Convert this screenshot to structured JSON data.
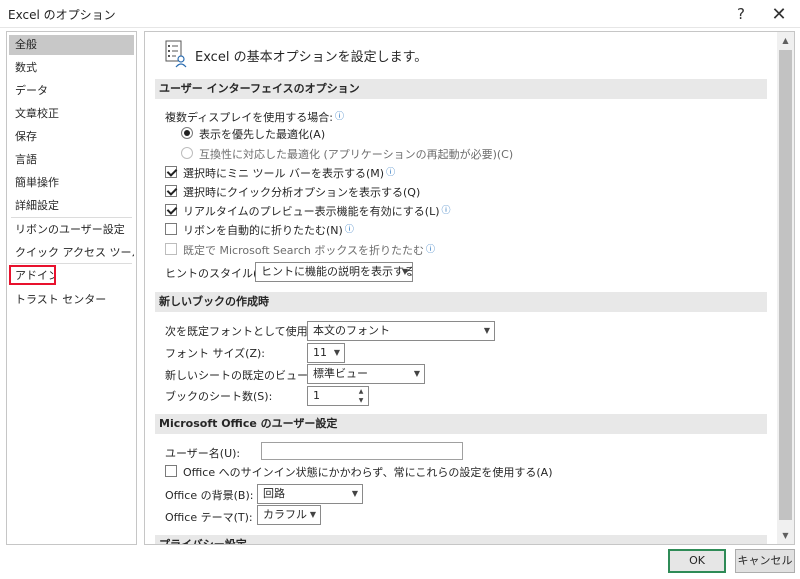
{
  "window": {
    "title": "Excel のオプション",
    "help_glyph": "?",
    "close_glyph": "✕"
  },
  "sidebar": {
    "items": [
      {
        "label": "全般"
      },
      {
        "label": "数式"
      },
      {
        "label": "データ"
      },
      {
        "label": "文章校正"
      },
      {
        "label": "保存"
      },
      {
        "label": "言語"
      },
      {
        "label": "簡単操作"
      },
      {
        "label": "詳細設定"
      },
      {
        "label": "リボンのユーザー設定"
      },
      {
        "label": "クイック アクセス ツール バー"
      },
      {
        "label": "アドイン"
      },
      {
        "label": "トラスト センター"
      }
    ]
  },
  "main": {
    "header": "Excel の基本オプションを設定します。",
    "ui_section": {
      "title": "ユーザー インターフェイスのオプション",
      "multi_display_label": "複数ディスプレイを使用する場合:",
      "radio_optimize_appearance": "表示を優先した最適化(A)",
      "radio_optimize_compat": "互換性に対応した最適化 (アプリケーションの再起動が必要)(C)",
      "cb_mini_toolbar": "選択時にミニ ツール バーを表示する(M)",
      "cb_quick_analysis": "選択時にクイック分析オプションを表示する(Q)",
      "cb_live_preview": "リアルタイムのプレビュー表示機能を有効にする(L)",
      "cb_collapse_ribbon": "リボンを自動的に折りたたむ(N)",
      "cb_collapse_search": "既定で Microsoft Search ボックスを折りたたむ",
      "tooltip_style_label": "ヒントのスタイル(R):",
      "tooltip_style_value": "ヒントに機能の説明を表示する"
    },
    "workbook_section": {
      "title": "新しいブックの作成時",
      "default_font_label": "次を既定フォントとして使用(N):",
      "default_font_value": "本文のフォント",
      "font_size_label": "フォント サイズ(Z):",
      "font_size_value": "11",
      "default_view_label": "新しいシートの既定のビュー(V):",
      "default_view_value": "標準ビュー",
      "sheet_count_label": "ブックのシート数(S):",
      "sheet_count_value": "1"
    },
    "user_section": {
      "title": "Microsoft Office のユーザー設定",
      "username_label": "ユーザー名(U):",
      "username_value": "",
      "cb_always_use": "Office へのサインイン状態にかかわらず、常にこれらの設定を使用する(A)",
      "background_label": "Office の背景(B):",
      "background_value": "回路",
      "theme_label": "Office テーマ(T):",
      "theme_value": "カラフル"
    },
    "privacy_section": {
      "title": "プライバシー設定"
    }
  },
  "footer": {
    "ok_label": "OK",
    "cancel_label": "キャンセル"
  },
  "colors": {
    "selected_nav_bg": "#c8c8c8",
    "highlight_box": "#e8112d",
    "ok_border": "#2f8b57",
    "section_bar_bg": "#e8e8e8",
    "info_icon": "#1f6dbb"
  }
}
